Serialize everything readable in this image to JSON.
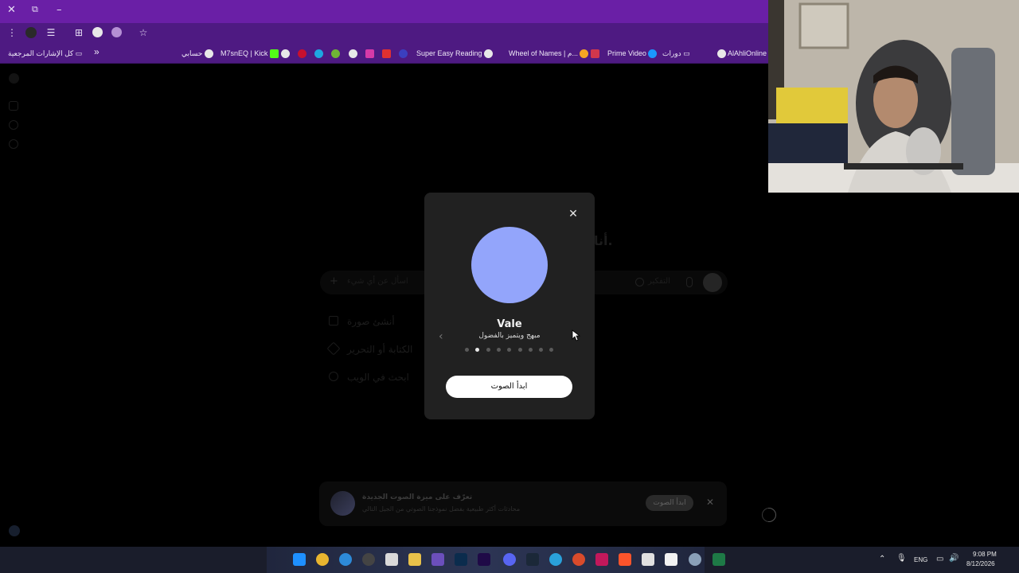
{
  "browser": {
    "window_buttons": {
      "close": "✕",
      "restore": "⧉",
      "minimize": "–"
    },
    "bookmarks": {
      "all_bookmarks": "كل الإشارات المرجعية",
      "overflow": "»",
      "items": [
        {
          "label": "حسابي",
          "icon": "globe-icon"
        },
        {
          "label": "M7snEQ | Kick",
          "icon": "kick-icon"
        },
        {
          "label": "Super Easy Reading",
          "icon": "globe-icon"
        },
        {
          "label": "Wheel of Names | م...",
          "icon": "globe-icon"
        },
        {
          "label": "Prime Video",
          "icon": "prime-video-icon"
        },
        {
          "label": "دورات",
          "icon": "folder-icon"
        },
        {
          "label": "AlAhliOnline",
          "icon": "globe-icon"
        }
      ]
    }
  },
  "background_page": {
    "heading_fragment": "أنا.",
    "composer": {
      "placeholder": "اسأل عن أي شيء",
      "thinking_label": "التفكير",
      "plus": "+"
    },
    "suggestions": [
      {
        "label": "أنشئ صورة"
      },
      {
        "label": "الكتابة أو التحرير"
      },
      {
        "label": "ابحث في الويب"
      }
    ]
  },
  "voice_modal": {
    "close": "✕",
    "voice_name": "Vale",
    "voice_description": "مبهج ويتميز بالفضول",
    "prev": "‹",
    "dots_count": 9,
    "active_dot": 1,
    "start_button": "ابدأ الصوت",
    "orb_color": "#93a5fb"
  },
  "banner": {
    "title": "تعرّف على ميزة الصوت الجديدة",
    "subtitle": "محادثات أكثر طبيعية بفضل نموذجنا الصوتي من الجيل التالي",
    "button": "ابدأ الصوت",
    "close": "✕"
  },
  "taskbar": {
    "language": "ENG",
    "time": "9:08 PM",
    "date": "8/12/2026"
  },
  "colors": {
    "titlebar": "#6a1fa6",
    "toolbar": "#4e1a82",
    "modal_bg": "#212121",
    "button_bg": "#ffffff"
  }
}
